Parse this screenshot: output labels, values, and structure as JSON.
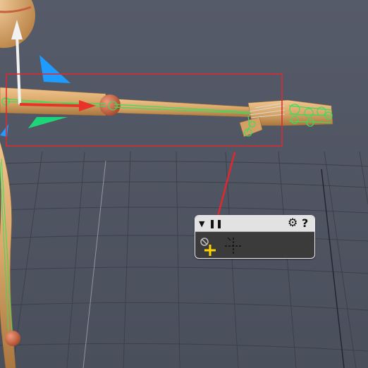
{
  "viewport": {
    "background_color": "#4f5462",
    "grid_color": "#3b3f4b",
    "figure_color": "#d9a86a",
    "joint_color": "#c8603e",
    "bone_color": "#3ddc5e",
    "selection_box_color": "#e0282e",
    "callout_arrow_color": "#e0282e",
    "gizmo": {
      "x_axis_color": "#e8322a",
      "y_axis_color": "#f2f2f2",
      "plane_handle_blue": "#1e9cff",
      "plane_handle_green": "#1ed67a"
    }
  },
  "tool_panel": {
    "collapse_icon": "triangle-down-icon",
    "pause_icon": "pause-icon",
    "settings_icon": "gear-icon",
    "help_icon": "question-mark-icon",
    "help_glyph": "?",
    "tools": [
      {
        "name": "add-ik-handle",
        "icon": "plus-crosshair-icon",
        "active": true,
        "accent": "#ffd400"
      },
      {
        "name": "dashed-crosshair",
        "icon": "dashed-crosshair-icon",
        "active": false
      }
    ]
  }
}
